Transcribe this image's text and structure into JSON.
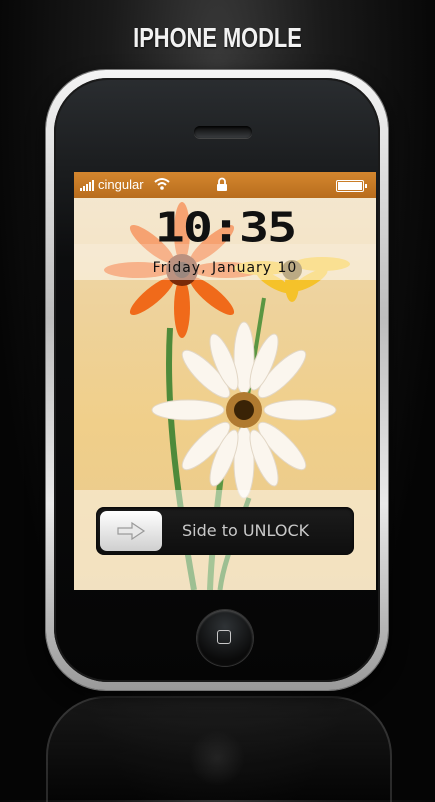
{
  "page": {
    "title": "IPHONE MODLE"
  },
  "status_bar": {
    "carrier": "cingular",
    "icons": [
      "signal-icon",
      "wifi-icon",
      "lock-icon",
      "battery-icon"
    ]
  },
  "lock_screen": {
    "time": "10:35",
    "date": "Friday, January 10"
  },
  "unlock_slider": {
    "label": "Side to UNLOCK",
    "knob_icon": "arrow-right-icon"
  },
  "colors": {
    "status_bar": "#c47a25",
    "background": "#000000",
    "phone_frame": "#d0d0d0"
  }
}
